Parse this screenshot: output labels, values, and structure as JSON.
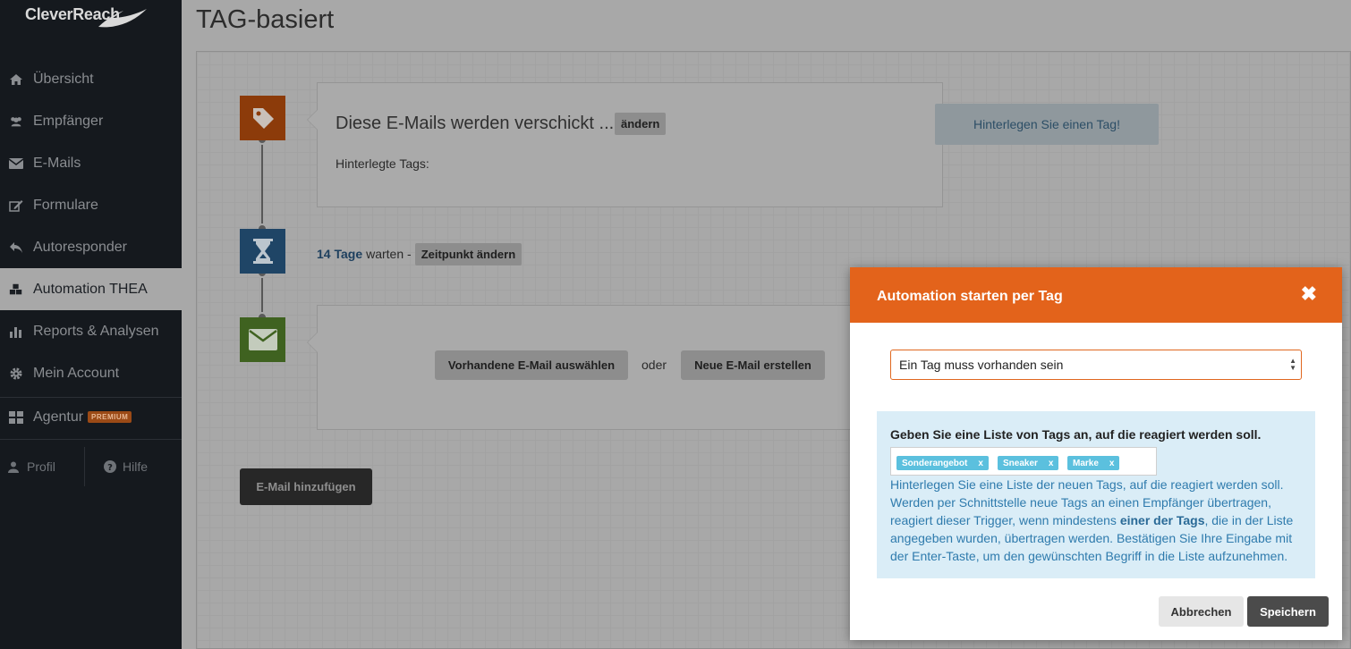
{
  "app": {
    "logo": "CleverReach"
  },
  "sidebar": {
    "items": [
      {
        "label": "Übersicht",
        "icon": "home-icon"
      },
      {
        "label": "Empfänger",
        "icon": "users-icon"
      },
      {
        "label": "E-Mails",
        "icon": "envelope-icon"
      },
      {
        "label": "Formulare",
        "icon": "edit-icon"
      },
      {
        "label": "Autoresponder",
        "icon": "reply-icon"
      },
      {
        "label": "Automation THEA",
        "icon": "cubes-icon",
        "active": true
      },
      {
        "label": "Reports & Analysen",
        "icon": "bar-chart-icon"
      },
      {
        "label": "Mein Account",
        "icon": "gear-icon"
      },
      {
        "label": "Agentur",
        "icon": "grid-icon",
        "badge": "PREMIUM"
      }
    ],
    "footer": {
      "profile": "Profil",
      "help": "Hilfe"
    }
  },
  "page": {
    "title": "TAG-basiert"
  },
  "workflow": {
    "trigger": {
      "title": "Diese E-Mails werden verschickt ...",
      "change_label": "ändern",
      "tags_label": "Hinterlegte Tags:",
      "hint": "Hinterlegen Sie einen Tag!"
    },
    "wait": {
      "duration": "14 Tage",
      "text": "warten -",
      "change_label": "Zeitpunkt ändern"
    },
    "email_step": {
      "select_existing": "Vorhandene E-Mail auswählen",
      "or": "oder",
      "create_new": "Neue E-Mail erstellen"
    },
    "add_email": "E-Mail hinzufügen"
  },
  "modal": {
    "title": "Automation starten per Tag",
    "close": "✖",
    "select_value": "Ein Tag muss vorhanden sein",
    "info_title": "Geben Sie eine Liste von Tags an, auf die reagiert werden soll.",
    "tags": [
      "Sonderangebot",
      "Sneaker",
      "Marke"
    ],
    "tag_remove": "x",
    "info_text_1": "Hinterlegen Sie eine Liste der neuen Tags, auf die reagiert werden soll. Werden per Schnittstelle neue Tags an einen Empfänger übertragen, reagiert dieser Trigger, wenn mindestens ",
    "info_text_bold": "einer der Tags",
    "info_text_2": ", die in der Liste angegeben wurden, übertragen werden. Bestätigen Sie Ihre Eingabe mit der Enter-Taste, um den gewünschten Begriff in die Liste aufzunehmen.",
    "cancel": "Abbrechen",
    "save": "Speichern"
  },
  "colors": {
    "accent": "#e3631b",
    "sidebar_bg": "#15191e",
    "info_bg": "#daedf7",
    "tag_bg": "#5bc0de"
  }
}
